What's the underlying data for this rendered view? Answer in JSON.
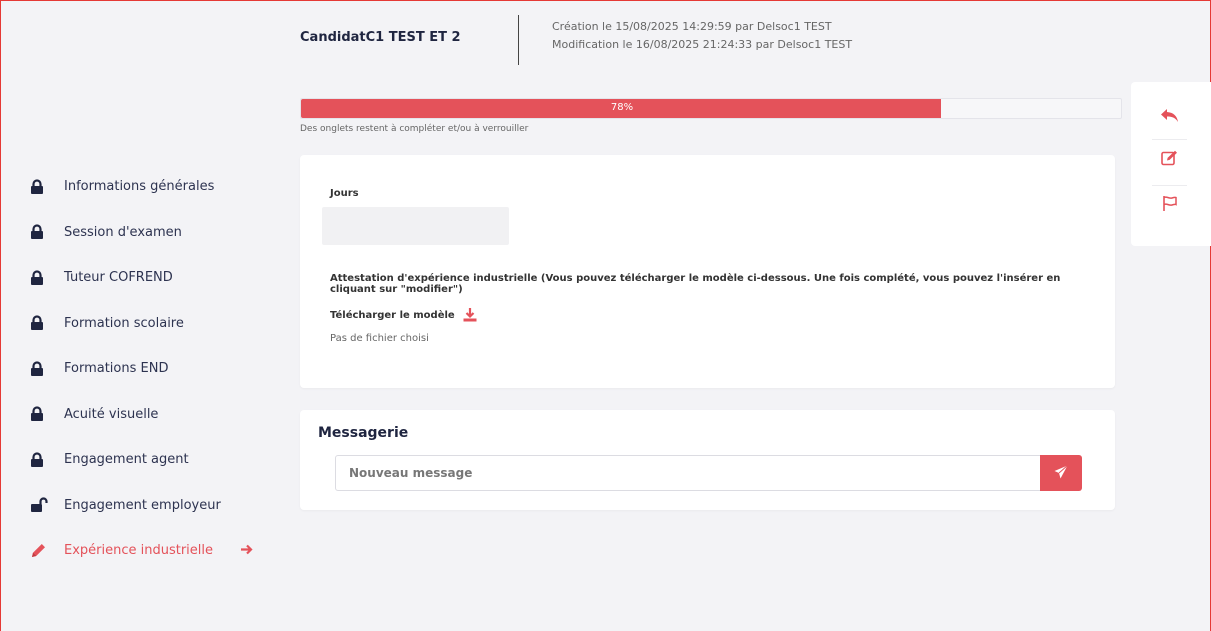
{
  "header": {
    "candidate_name": "CandidatC1 TEST ET 2",
    "created": "Création le 15/08/2025 14:29:59 par Delsoc1 TEST",
    "modified": "Modification le 16/08/2025 21:24:33 par Delsoc1 TEST"
  },
  "progress": {
    "value_percent": 78,
    "label": "78%",
    "note": "Des onglets restent à compléter et/ou à verrouiller"
  },
  "sidebar": {
    "items": [
      {
        "label": "Informations générales",
        "icon": "lock-icon"
      },
      {
        "label": "Session d'examen",
        "icon": "lock-icon"
      },
      {
        "label": "Tuteur COFREND",
        "icon": "lock-icon"
      },
      {
        "label": "Formation scolaire",
        "icon": "lock-icon"
      },
      {
        "label": "Formations END",
        "icon": "lock-icon"
      },
      {
        "label": "Acuité visuelle",
        "icon": "lock-icon"
      },
      {
        "label": "Engagement agent",
        "icon": "lock-icon"
      },
      {
        "label": "Engagement employeur",
        "icon": "unlock-icon"
      },
      {
        "label": "Expérience industrielle",
        "icon": "pencil-icon",
        "active": true
      }
    ]
  },
  "form": {
    "jours_label": "Jours",
    "attestation_label": "Attestation d'expérience industrielle (Vous pouvez télécharger le modèle ci-dessous. Une fois complété, vous pouvez l'insérer en cliquant sur \"modifier\")",
    "download_label": "Télécharger le modèle",
    "no_file": "Pas de fichier choisi"
  },
  "messaging": {
    "title": "Messagerie",
    "placeholder": "Nouveau message"
  },
  "actions": [
    "undo-icon",
    "edit-icon",
    "flag-icon"
  ],
  "colors": {
    "accent": "#e4525a",
    "text_dark": "#1f2540",
    "background": "#f3f3f6"
  }
}
